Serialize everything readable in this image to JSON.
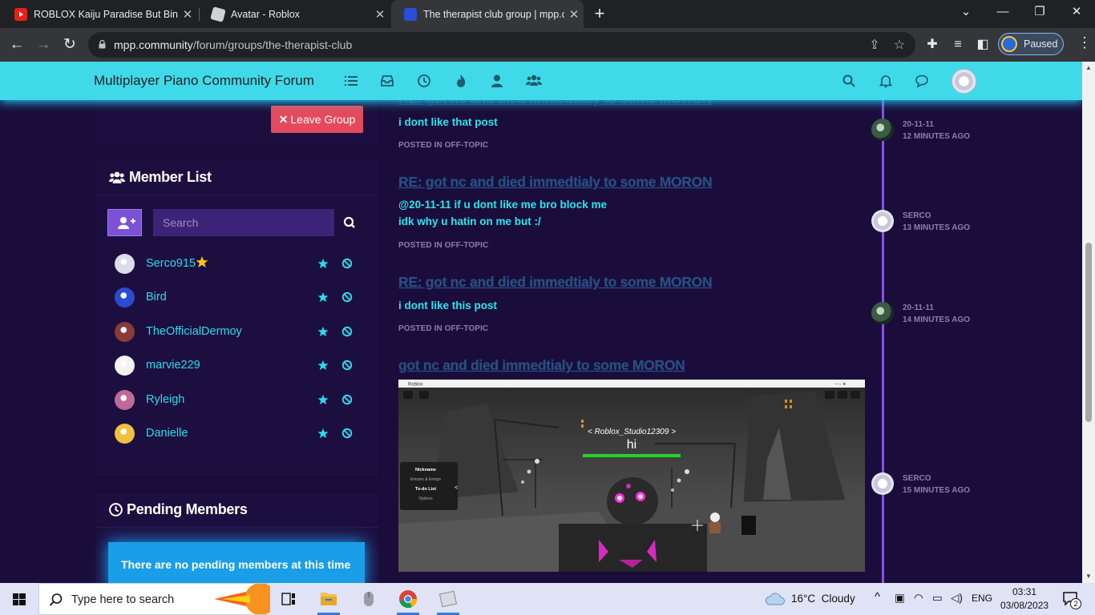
{
  "browser": {
    "tabs": [
      {
        "title": "ROBLOX Kaiju Paradise But Bingo",
        "icon": "youtube-icon",
        "active": false
      },
      {
        "title": "Avatar - Roblox",
        "icon": "roblox-icon",
        "active": false
      },
      {
        "title": "The therapist club group | mpp.co",
        "icon": "mpp-icon",
        "active": true
      }
    ],
    "url_domain": "mpp.community",
    "url_path": "/forum/groups/the-therapist-club",
    "profile_label": "Paused"
  },
  "site": {
    "brand": "Multiplayer Piano Community Forum",
    "nav_icons": [
      "list-icon",
      "inbox-icon",
      "clock-icon",
      "fire-icon",
      "user-icon",
      "users-icon"
    ],
    "right_icons": [
      "search-icon",
      "bell-icon",
      "chat-icon"
    ]
  },
  "sidebar": {
    "leave_label": "Leave Group",
    "member_list_title": "Member List",
    "search_placeholder": "Search",
    "members": [
      {
        "name": "Serco915",
        "owner": true,
        "avatar_color": "#dcdcec"
      },
      {
        "name": "Bird",
        "owner": false,
        "avatar_color": "#2a4bd0"
      },
      {
        "name": "TheOfficialDermoy",
        "owner": false,
        "avatar_color": "#8a3a3a"
      },
      {
        "name": "marvie229",
        "owner": false,
        "avatar_color": "#f2f2f2"
      },
      {
        "name": "Ryleigh",
        "owner": false,
        "avatar_color": "#c06a9a"
      },
      {
        "name": "Danielle",
        "owner": false,
        "avatar_color": "#f0c040"
      }
    ],
    "pending_title": "Pending Members",
    "pending_empty": "There are no pending members at this time"
  },
  "posts": [
    {
      "title": "",
      "body": [
        "i dont like that post"
      ],
      "category": "POSTED IN OFF-TOPIC"
    },
    {
      "title": "RE: got nc and died immedtialy to some MORON",
      "body": [
        "@20-11-11 if u dont like me bro block me",
        "idk why u hatin on me but :/"
      ],
      "category": "POSTED IN OFF-TOPIC"
    },
    {
      "title": "RE: got nc and died immedtialy to some MORON",
      "body": [
        "i dont like this post"
      ],
      "category": "POSTED IN OFF-TOPIC"
    },
    {
      "title": "got nc and died immedtialy to some MORON",
      "body": [],
      "category": ""
    }
  ],
  "timeline": [
    {
      "user": "20-11-11",
      "time": "12 MINUTES AGO"
    },
    {
      "user": "SERCO",
      "time": "13 MINUTES AGO"
    },
    {
      "user": "20-11-11",
      "time": "14 MINUTES AGO"
    },
    {
      "user": "SERCO",
      "time": "15 MINUTES AGO"
    }
  ],
  "embedded_screenshot": {
    "window_title": "Roblox",
    "player_name": "< Roblox_Studio12309 >",
    "chat_bubble": "hi",
    "menu": [
      "Nickname",
      "Emotes & Emojis",
      "To-do List",
      "Options"
    ]
  },
  "taskbar": {
    "search_placeholder": "Type here to search",
    "weather": "16°C  Cloudy",
    "language": "ENG",
    "time": "03:31",
    "date": "03/08/2023",
    "notifications": "2"
  }
}
